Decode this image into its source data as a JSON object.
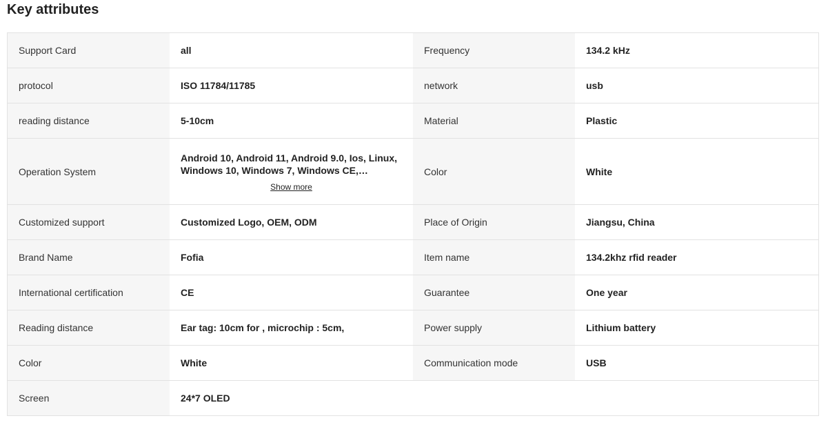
{
  "section": {
    "title": "Key attributes"
  },
  "rows": [
    {
      "k1": "Support Card",
      "v1": "all",
      "k2": "Frequency",
      "v2": "134.2 kHz"
    },
    {
      "k1": "protocol",
      "v1": "ISO 11784/11785",
      "k2": "network",
      "v2": "usb"
    },
    {
      "k1": "reading distance",
      "v1": "5-10cm",
      "k2": "Material",
      "v2": "Plastic"
    },
    {
      "k1": "Operation System",
      "v1": "Android 10, Android 11, Android 9.0, Ios, Linux, Windows 10, Windows 7, Windows CE, Windows...",
      "v1_more": "Show more",
      "k2": "Color",
      "v2": "White"
    },
    {
      "k1": "Customized support",
      "v1": "Customized Logo, OEM, ODM",
      "k2": "Place of Origin",
      "v2": "Jiangsu, China"
    },
    {
      "k1": "Brand Name",
      "v1": "Fofia",
      "k2": "Item name",
      "v2": "134.2khz rfid reader"
    },
    {
      "k1": "International certification",
      "v1": "CE",
      "k2": "Guarantee",
      "v2": "One year"
    },
    {
      "k1": "Reading distance",
      "v1": "Ear tag: 10cm for , microchip : 5cm,",
      "k2": "Power supply",
      "v2": "Lithium battery"
    },
    {
      "k1": "Color",
      "v1": "White",
      "k2": "Communication mode",
      "v2": "USB"
    },
    {
      "k1": "Screen",
      "v1": "24*7 OLED"
    }
  ]
}
